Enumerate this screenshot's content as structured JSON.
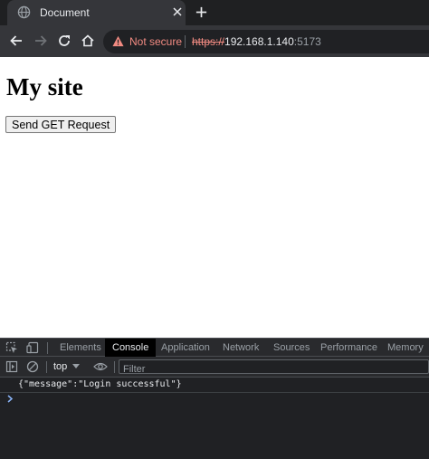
{
  "browser": {
    "tab": {
      "title": "Document"
    },
    "address_bar": {
      "security_label": "Not secure",
      "url_scheme": "https://",
      "url_host": "192.168.1.140",
      "url_port": ":5173"
    }
  },
  "page": {
    "heading": "My site",
    "button_label": "Send GET Request"
  },
  "devtools": {
    "tabs": [
      "Elements",
      "Console",
      "Application",
      "Network",
      "Sources",
      "Performance",
      "Memory"
    ],
    "active_tab": "Console",
    "context": "top",
    "filter_placeholder": "Filter",
    "console_messages": [
      "{\"message\":\"Login successful\"}"
    ]
  },
  "colors": {
    "tab_strip": "#1f2022",
    "toolbar": "#35363a",
    "warning": "#f28b82",
    "devtools_bg": "#202124",
    "prompt": "#8ab4f8"
  }
}
